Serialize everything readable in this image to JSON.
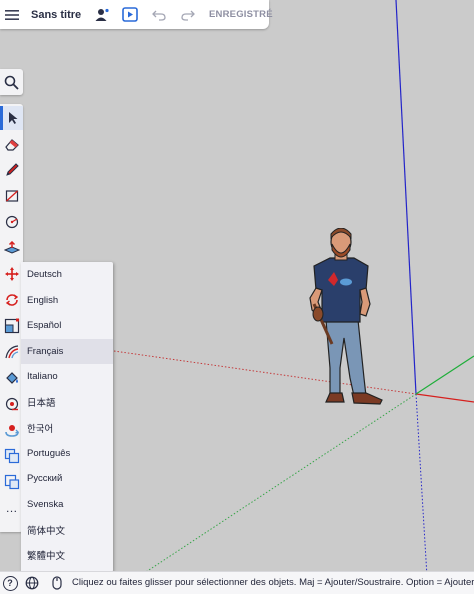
{
  "header": {
    "document_title": "Sans titre",
    "save_status": "ENREGISTRÉ"
  },
  "language_menu": {
    "items": [
      "Deutsch",
      "English",
      "Español",
      "Français",
      "Italiano",
      "日本語",
      "한국어",
      "Português",
      "Русский",
      "Svenska",
      "简体中文",
      "繁體中文"
    ],
    "selected": "Français"
  },
  "statusbar": {
    "help_label": "?",
    "hint": "Cliquez ou faites glisser pour sélectionner des objets. Maj = Ajouter/Soustraire. Option = Ajouter."
  },
  "toolbar": {
    "more_label": "…"
  },
  "colors": {
    "accent": "#2a6ad8",
    "axis_red": "#d6201e",
    "axis_green": "#1fae3a",
    "axis_blue": "#2324c9",
    "viewport": "#cbcbcb"
  }
}
